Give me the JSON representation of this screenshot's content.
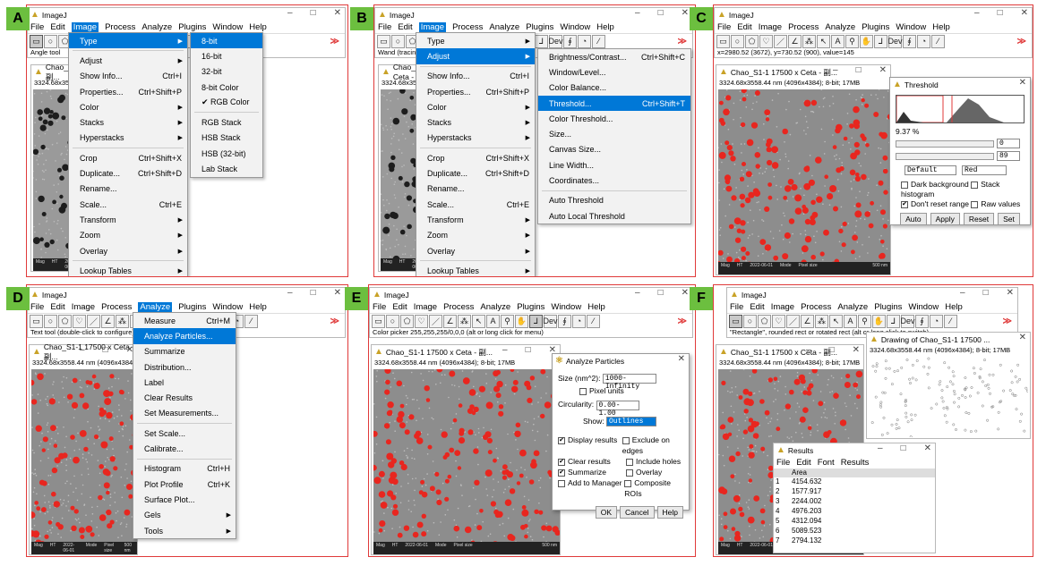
{
  "colors": {
    "label_bg": "#6cbf3f",
    "border": "#e03a3a",
    "accent": "#0078d7",
    "particle": "#e8261f"
  },
  "common": {
    "app_title": "ImageJ",
    "menus": [
      "File",
      "Edit",
      "Image",
      "Process",
      "Analyze",
      "Plugins",
      "Window",
      "Help"
    ],
    "image_title": "Chao_S1-1 17500 x Ceta - 副...",
    "image_info": "3324.68x3558.44 nm (4096x4384); 8-bit; 17MB",
    "scale_label": "500 nm",
    "bottom": [
      "Mag",
      "HT",
      "2022-06-01",
      "Mode",
      "Pixel size",
      "17500 x",
      "120 kV",
      "TEM",
      "815.5 pm"
    ]
  },
  "panels": [
    {
      "label": "A",
      "status": "Angle tool",
      "image_menu": [
        {
          "l": "Type",
          "s": "",
          "sub": true
        },
        {
          "l": "Adjust",
          "s": "",
          "sub": true
        },
        {
          "l": "Show Info...",
          "s": "Ctrl+I"
        },
        {
          "l": "Properties...",
          "s": "Ctrl+Shift+P"
        },
        {
          "l": "Color",
          "s": "",
          "sub": true
        },
        {
          "l": "Stacks",
          "s": "",
          "sub": true
        },
        {
          "l": "Hyperstacks",
          "s": "",
          "sub": true
        },
        {
          "l": "Crop",
          "s": "Ctrl+Shift+X"
        },
        {
          "l": "Duplicate...",
          "s": "Ctrl+Shift+D"
        },
        {
          "l": "Rename...",
          "s": ""
        },
        {
          "l": "Scale...",
          "s": "Ctrl+E"
        },
        {
          "l": "Transform",
          "s": "",
          "sub": true
        },
        {
          "l": "Zoom",
          "s": "",
          "sub": true
        },
        {
          "l": "Overlay",
          "s": "",
          "sub": true
        },
        {
          "l": "Lookup Tables",
          "s": "",
          "sub": true
        }
      ],
      "type_menu": [
        "8-bit",
        "16-bit",
        "32-bit",
        "8-bit Color",
        "✔ RGB Color",
        "RGB Stack",
        "HSB Stack",
        "HSB (32-bit)",
        "Lab Stack"
      ]
    },
    {
      "label": "B",
      "status": "Wand (tracing) tool",
      "image_menu": [
        "Type",
        "Adjust",
        "Show Info...",
        "Properties...",
        "Color",
        "Stacks",
        "Hyperstacks",
        "Crop",
        "Duplicate...",
        "Rename...",
        "Scale...",
        "Transform",
        "Zoom",
        "Overlay",
        "Lookup Tables"
      ],
      "image_menu_sc": [
        "",
        "",
        "Ctrl+I",
        "Ctrl+Shift+P",
        "",
        "",
        "",
        "Ctrl+Shift+X",
        "Ctrl+Shift+D",
        "",
        "Ctrl+E",
        "",
        "",
        "",
        ""
      ],
      "adjust_menu": [
        {
          "l": "Brightness/Contrast...",
          "s": "Ctrl+Shift+C"
        },
        {
          "l": "Window/Level...",
          "s": ""
        },
        {
          "l": "Color Balance...",
          "s": ""
        },
        {
          "l": "Threshold...",
          "s": "Ctrl+Shift+T"
        },
        {
          "l": "Color Threshold...",
          "s": ""
        },
        {
          "l": "Size...",
          "s": ""
        },
        {
          "l": "Canvas Size...",
          "s": ""
        },
        {
          "l": "Line Width...",
          "s": ""
        },
        {
          "l": "Coordinates...",
          "s": ""
        },
        {
          "l": "Auto Threshold",
          "s": ""
        },
        {
          "l": "Auto Local Threshold",
          "s": ""
        }
      ]
    },
    {
      "label": "C",
      "status": "x=2980.52 (3672), y=730.52 (900), value=145",
      "threshold": {
        "title": "Threshold",
        "pct": "9.37 %",
        "min": "0",
        "max": "89",
        "method": "Default",
        "mode": "Red",
        "dark_bg": "Dark background",
        "stack_hist": "Stack histogram",
        "dont_reset": "Don't reset range",
        "raw": "Raw values",
        "buttons": [
          "Auto",
          "Apply",
          "Reset",
          "Set"
        ]
      }
    },
    {
      "label": "D",
      "status": "Text tool (double-click to configure)",
      "analyze_menu": [
        {
          "l": "Measure",
          "s": "Ctrl+M"
        },
        {
          "l": "Analyze Particles...",
          "s": ""
        },
        {
          "l": "Summarize",
          "s": ""
        },
        {
          "l": "Distribution...",
          "s": ""
        },
        {
          "l": "Label",
          "s": ""
        },
        {
          "l": "Clear Results",
          "s": ""
        },
        {
          "l": "Set Measurements...",
          "s": ""
        },
        {
          "l": "Set Scale...",
          "s": ""
        },
        {
          "l": "Calibrate...",
          "s": ""
        },
        {
          "l": "Histogram",
          "s": "Ctrl+H"
        },
        {
          "l": "Plot Profile",
          "s": "Ctrl+K"
        },
        {
          "l": "Surface Plot...",
          "s": ""
        },
        {
          "l": "Gels",
          "s": "",
          "sub": true
        },
        {
          "l": "Tools",
          "s": "",
          "sub": true
        }
      ]
    },
    {
      "label": "E",
      "status": "Color picker 255,255,255/0,0,0 (alt or long click for menu)",
      "dialog": {
        "title": "Analyze Particles",
        "size_label": "Size (nm^2):",
        "size": "1000-Infinity",
        "pixel_units": "Pixel units",
        "circ_label": "Circularity:",
        "circ": "0.00-1.00",
        "show_label": "Show:",
        "show": "Outlines",
        "checks": [
          [
            "Display results",
            true,
            "Exclude on edges",
            false
          ],
          [
            "Clear results",
            true,
            "Include holes",
            false
          ],
          [
            "Summarize",
            true,
            "Overlay",
            false
          ],
          [
            "Add to Manager",
            false,
            "Composite ROIs",
            false
          ]
        ],
        "buttons": [
          "OK",
          "Cancel",
          "Help"
        ]
      }
    },
    {
      "label": "F",
      "status": "\"Rectangle\", rounded rect or rotated rect (alt or long click to switch)",
      "drawing_title": "Drawing of Chao_S1-1 17500 ...",
      "results": {
        "title": "Results",
        "menus": [
          "File",
          "Edit",
          "Font",
          "Results"
        ],
        "header": "Area",
        "rows": [
          [
            "1",
            "4154.632"
          ],
          [
            "2",
            "1577.917"
          ],
          [
            "3",
            "2244.002"
          ],
          [
            "4",
            "4976.203"
          ],
          [
            "5",
            "4312.094"
          ],
          [
            "6",
            "5089.523"
          ],
          [
            "7",
            "2794.132"
          ]
        ]
      }
    }
  ]
}
